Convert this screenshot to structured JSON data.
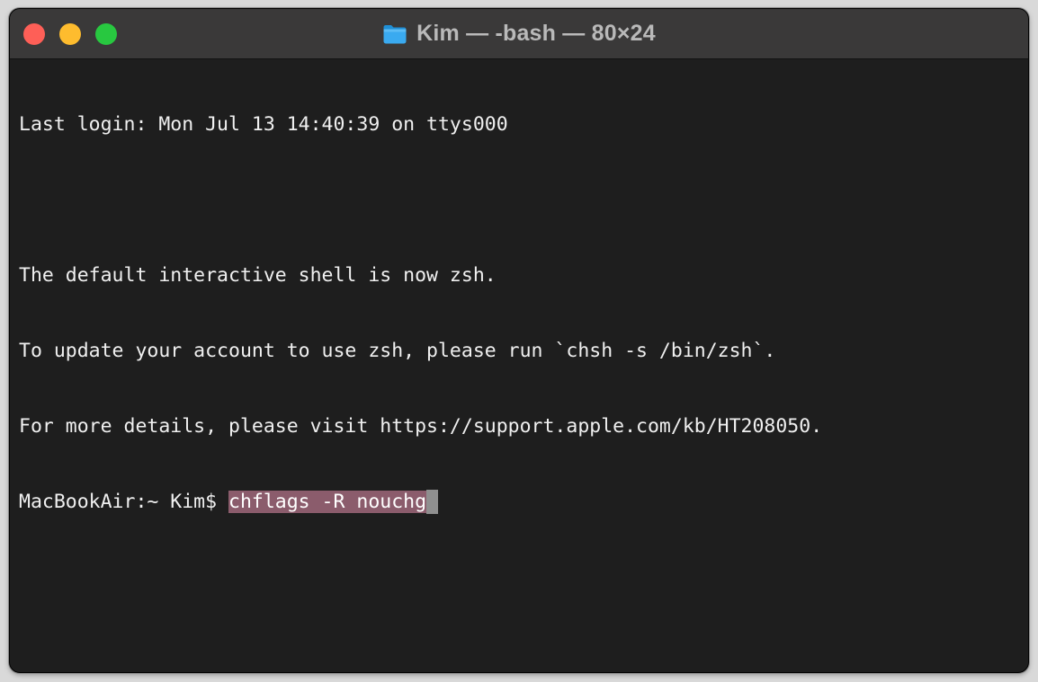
{
  "window": {
    "title": "Kim — -bash — 80×24",
    "title_icon": "folder-icon",
    "colors": {
      "close": "#fe5f57",
      "minimize": "#febc2e",
      "zoom": "#28c840",
      "background": "#1e1e1e",
      "selection": "#8b5c6c"
    }
  },
  "terminal": {
    "lines": [
      "Last login: Mon Jul 13 14:40:39 on ttys000",
      "",
      "The default interactive shell is now zsh.",
      "To update your account to use zsh, please run `chsh -s /bin/zsh`.",
      "For more details, please visit https://support.apple.com/kb/HT208050."
    ],
    "prompt": "MacBookAir:~ Kim$ ",
    "command": "chflags -R nouchg"
  }
}
